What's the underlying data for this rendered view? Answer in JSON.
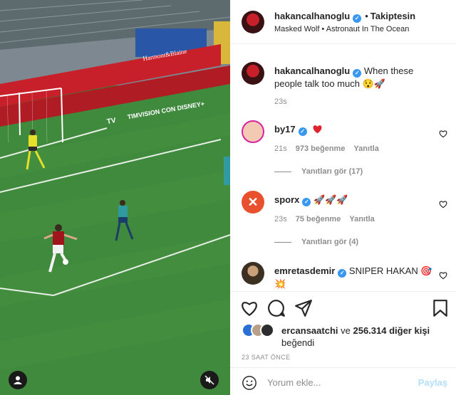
{
  "video": {
    "pitch_color": "#3d7a3a",
    "ad_banner": "Harmont&Blaine",
    "sponsor_board": "TIMVISION CON DISNEY+",
    "sponsor_logo": "TV"
  },
  "post": {
    "author": "hakancalhanoglu",
    "follow_status": "Takiptesin",
    "song": "Masked Wolf • Astronaut In The Ocean",
    "caption": "When these people talk too much 😯🚀",
    "caption_time": "23s"
  },
  "comments": [
    {
      "user": "by17",
      "text": "",
      "time": "21s",
      "likes": "973 beğenme",
      "reply": "Yanıtla",
      "view_replies": "Yanıtları gör (17)"
    },
    {
      "user": "sporx",
      "text": "🚀🚀🚀",
      "time": "23s",
      "likes": "75 beğenme",
      "reply": "Yanıtla",
      "view_replies": "Yanıtları gör (4)"
    },
    {
      "user": "emretasdemir",
      "text": "SNIPER HAKAN 🎯💥"
    }
  ],
  "likes": {
    "liker": "ercansaatchi",
    "connector": "ve",
    "others": "256.314 diğer kişi",
    "suffix": "beğendi"
  },
  "timestamp": "23 SAAT ÖNCE",
  "comment_box": {
    "placeholder": "Yorum ekle...",
    "share": "Paylaş"
  },
  "colors": {
    "verified": "#3897f0",
    "muted": "#8e8e8e",
    "share_disabled": "#b2dffc"
  }
}
